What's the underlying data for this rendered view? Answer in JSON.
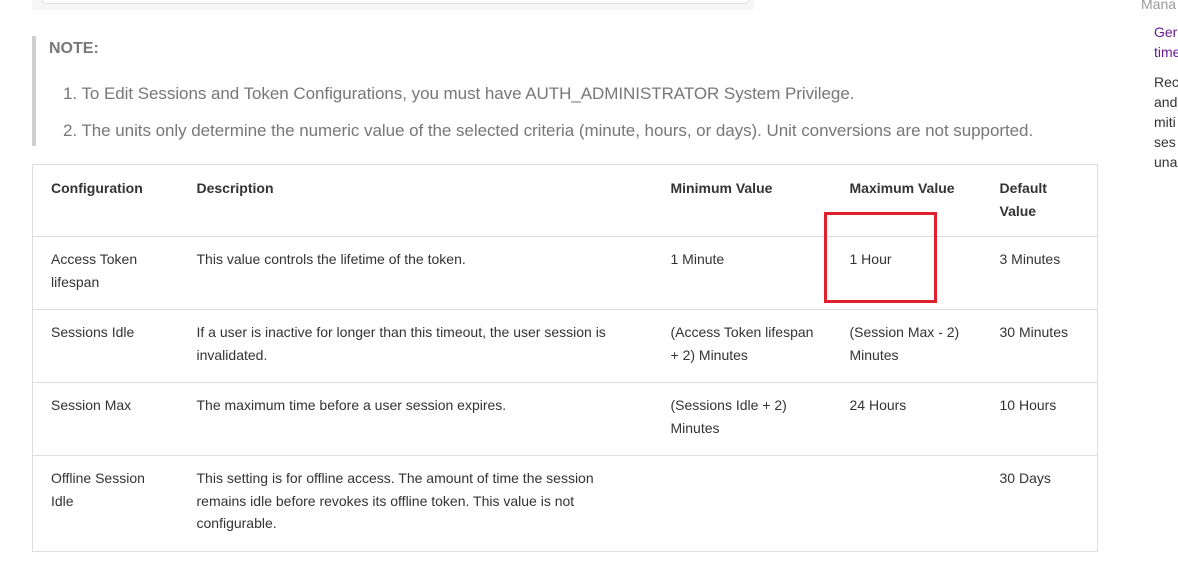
{
  "note": {
    "title": "NOTE:",
    "items": [
      "1. To Edit Sessions and Token Configurations, you must have AUTH_ADMINISTRATOR System Privilege.",
      "2. The units only determine the numeric value of the selected criteria (minute, hours, or days). Unit conversions are not supported."
    ]
  },
  "table": {
    "headers": [
      "Configuration",
      "Description",
      "Minimum Value",
      "Maximum Value",
      "Default Value"
    ],
    "rows": [
      [
        "Access Token lifespan",
        "This value controls the lifetime of the token.",
        "1 Minute",
        "1 Hour",
        "3 Minutes"
      ],
      [
        "Sessions Idle",
        "If a user is inactive for longer than this timeout, the user session is invalidated.",
        "(Access Token lifespan + 2) Minutes",
        "(Session Max - 2) Minutes",
        "30 Minutes"
      ],
      [
        "Session Max",
        "The maximum time before a user session expires.",
        "(Sessions Idle + 2) Minutes",
        "24 Hours",
        "10 Hours"
      ],
      [
        "Offline Session Idle",
        "This setting is for offline access. The amount of time the session remains idle before revokes its offline token. This value is not configurable.",
        "",
        "",
        "30 Days"
      ]
    ]
  },
  "sidebar": {
    "heading": "Mana",
    "link_lines": [
      "Ger",
      "time"
    ],
    "text_lines": [
      "Rec",
      "and",
      "miti",
      "ses",
      "una"
    ]
  },
  "colors": {
    "highlight": "#e0202a",
    "link": "#6a1b9a",
    "note_text": "#777777"
  }
}
